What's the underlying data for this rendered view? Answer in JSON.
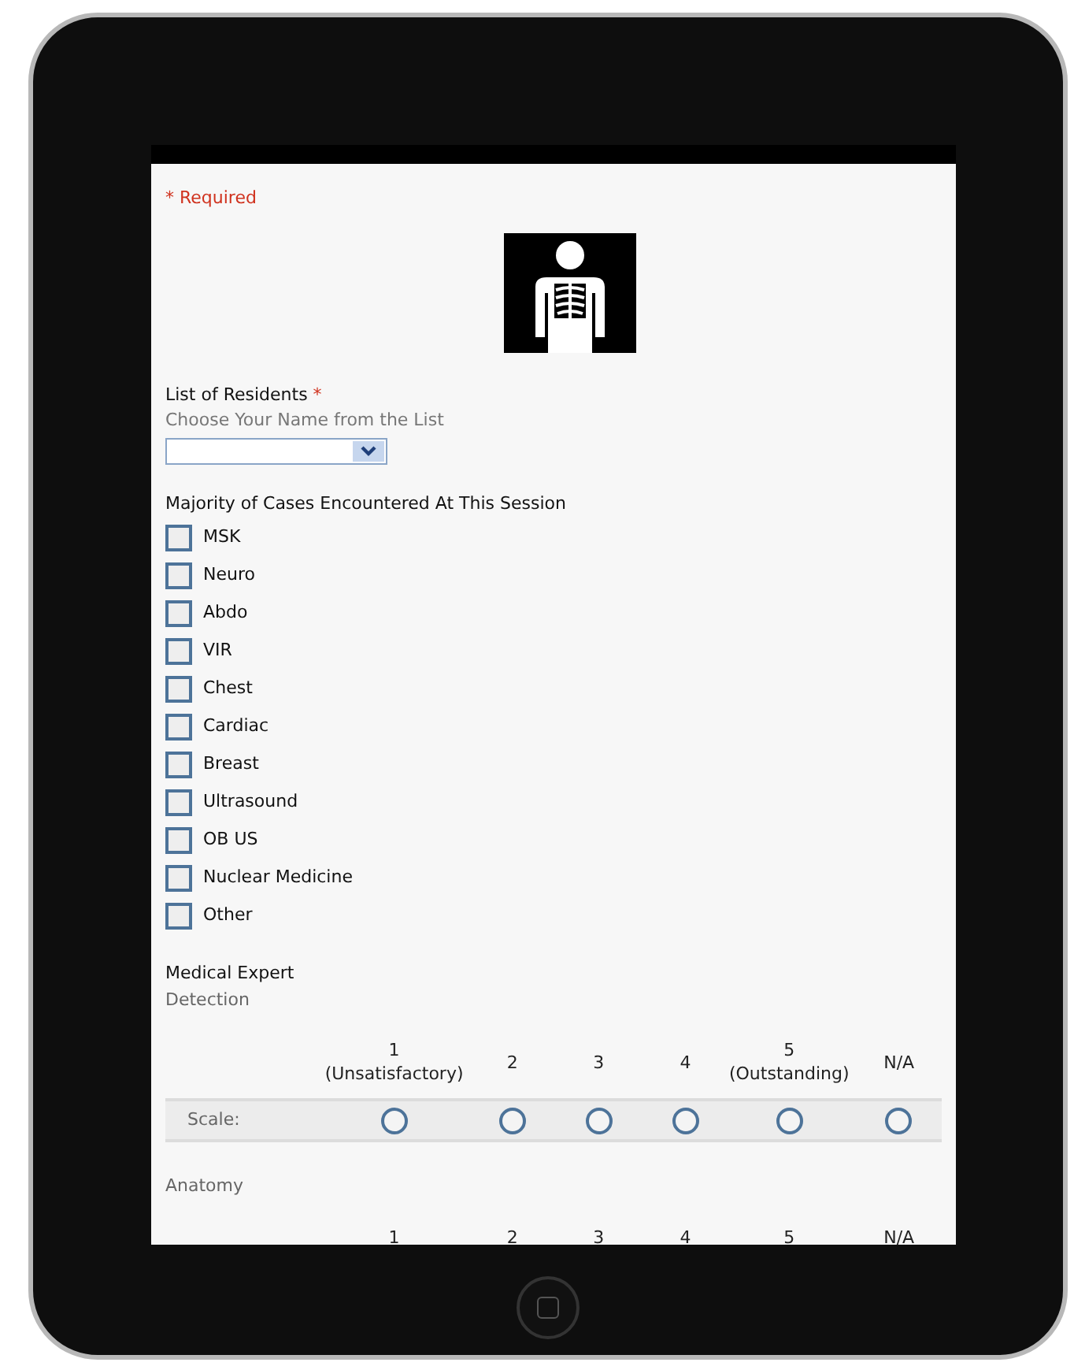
{
  "required_note": "* Required",
  "residents": {
    "label": "List of Residents",
    "required_mark": "*",
    "hint": "Choose Your Name from the List"
  },
  "cases": {
    "label": "Majority of Cases Encountered At This Session",
    "options": [
      {
        "label": "MSK",
        "checked": false
      },
      {
        "label": "Neuro",
        "checked": false
      },
      {
        "label": "Abdo",
        "checked": false
      },
      {
        "label": "VIR",
        "checked": false
      },
      {
        "label": "Chest",
        "checked": false
      },
      {
        "label": "Cardiac",
        "checked": false
      },
      {
        "label": "Breast",
        "checked": false
      },
      {
        "label": "Ultrasound",
        "checked": false
      },
      {
        "label": "OB US",
        "checked": false
      },
      {
        "label": "Nuclear Medicine",
        "checked": false
      },
      {
        "label": "Other",
        "checked": false
      }
    ]
  },
  "section_title": "Medical Expert",
  "ratings": [
    {
      "label": "Detection",
      "row_label": "Scale:",
      "columns": [
        {
          "value": "1",
          "caption": "(Unsatisfactory)"
        },
        {
          "value": "2"
        },
        {
          "value": "3"
        },
        {
          "value": "4"
        },
        {
          "value": "5",
          "caption": "(Outstanding)"
        },
        {
          "value": "N/A"
        }
      ],
      "choices": [
        {
          "selected": false
        },
        {
          "selected": false
        },
        {
          "selected": false
        },
        {
          "selected": false
        },
        {
          "selected": false
        },
        {
          "selected": false
        }
      ]
    },
    {
      "label": "Anatomy",
      "columns": [
        {
          "value": "1"
        },
        {
          "value": "2"
        },
        {
          "value": "3"
        },
        {
          "value": "4"
        },
        {
          "value": "5"
        },
        {
          "value": "N/A"
        }
      ]
    }
  ]
}
